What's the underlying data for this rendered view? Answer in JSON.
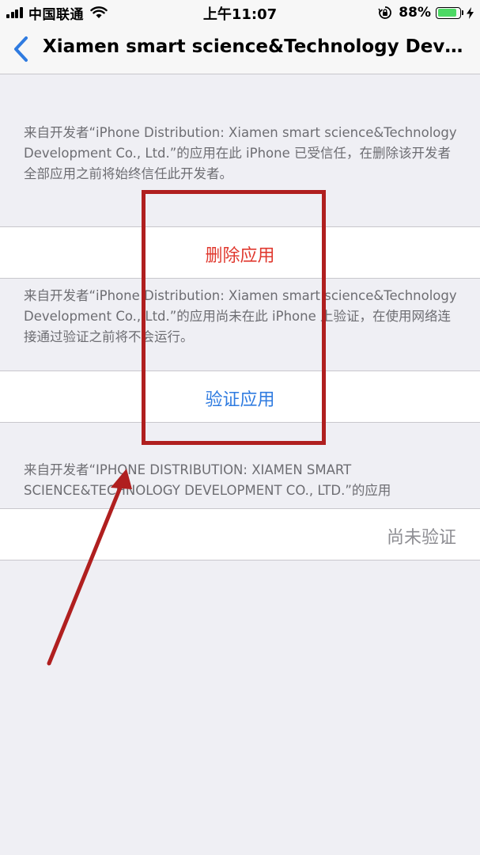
{
  "status_bar": {
    "carrier": "中国联通",
    "time": "上午11:07",
    "battery_percent": "88%",
    "battery_level": 0.88
  },
  "nav": {
    "title": "Xiamen smart science&Technology Develop..."
  },
  "sections": {
    "trusted_note": "来自开发者“iPhone Distribution: Xiamen smart science&Technology Development Co., Ltd.”的应用在此 iPhone 已受信任，在删除该开发者全部应用之前将始终信任此开发者。",
    "delete_apps_label": "删除应用",
    "verify_note": "来自开发者“iPhone Distribution: Xiamen smart science&Technology Development Co., Ltd.”的应用尚未在此 iPhone 上验证，在使用网络连接通过验证之前将不会运行。",
    "verify_apps_label": "验证应用",
    "apps_header": "来自开发者“IPHONE DISTRIBUTION: XIAMEN SMART SCIENCE&TECHNOLOGY DEVELOPMENT CO., LTD.”的应用",
    "app_status": "尚未验证"
  },
  "colors": {
    "destructive": "#e0392f",
    "tint": "#2f7be0",
    "annotation": "#b01f1f"
  }
}
